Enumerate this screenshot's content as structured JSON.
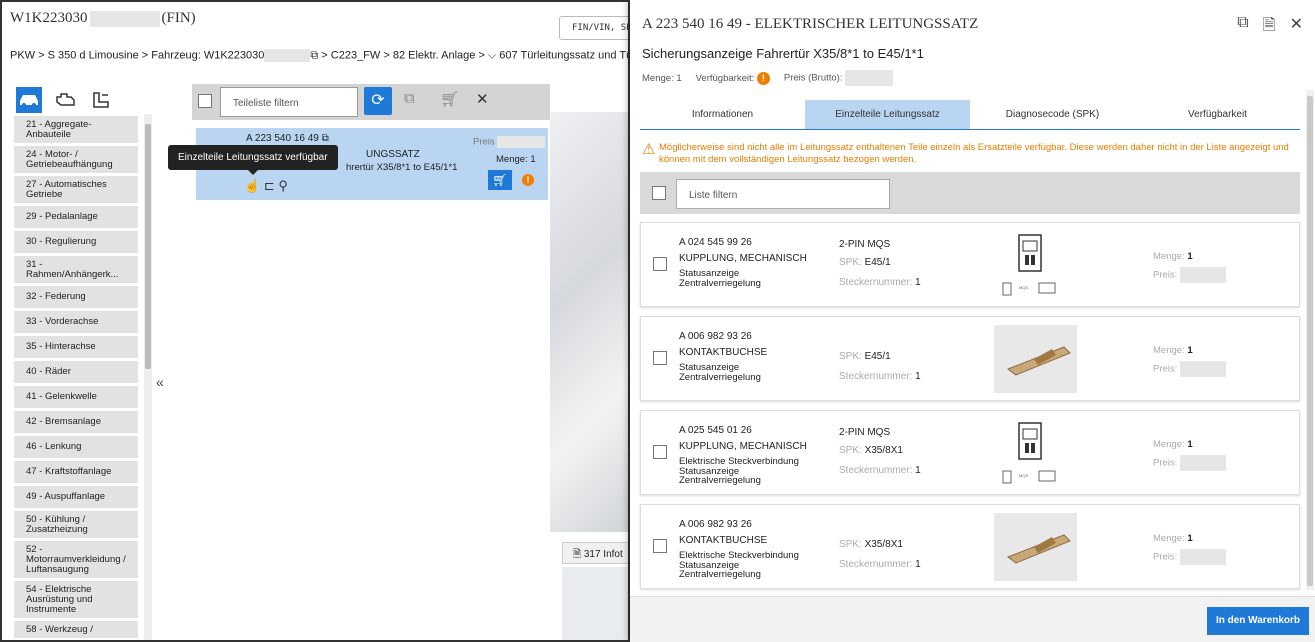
{
  "background_app": {
    "vin_prefix": "W1K223030",
    "vin_suffix": "(FIN)",
    "breadcrumb_start": "PKW > S 350 d Limousine > Fahrzeug: W1K223030",
    "breadcrumb_end": " > C223_FW  > 82 Elektr. Anlage > ⌵ 607 Türleitungssatz und Türst",
    "search_placeholder": "FIN/VIN, SPI",
    "categories": [
      "21 - Aggregate-Anbauteile",
      "24 - Motor- / Getriebeaufhängung",
      "27 - Automatisches Getriebe",
      "29 - Pedalanlage",
      "30 - Regulierung",
      "31 - Rahmen/Anhängerk...",
      "32 - Federung",
      "33 - Vorderachse",
      "35 - Hinterachse",
      "40 - Räder",
      "41 - Gelenkwelle",
      "42 - Bremsanlage",
      "46 - Lenkung",
      "47 - Kraftstoffanlage",
      "49 - Auspuffanlage",
      "50 - Kühlung / Zusatzheizung",
      "52 - Motorraumverkleidung / Luftansaugung",
      "54 - Elektrische Ausrüstung und Instrumente",
      "58 - Werkzeug /"
    ],
    "parts_filter_placeholder": "Teileliste filtern",
    "part_card": {
      "number": "A 223 540 16 49",
      "name": "UNGSSATZ",
      "description": "hrertür X35/8*1 to E45/1*1",
      "preis_label": "Preis",
      "menge": "Menge: 1"
    },
    "tooltip": "Einzelteile Leitungssatz verfügbar",
    "info_tab": "317 Infot"
  },
  "panel": {
    "title": "A 223 540 16 49 - ELEKTRISCHER LEITUNGSSATZ",
    "subtitle": "Sicherungsanzeige Fahrertür X35/8*1 to E45/1*1",
    "menge": "Menge: 1",
    "verfuegbarkeit": "Verfügbarkeit:",
    "preis": "Preis (Brutto):",
    "tabs": [
      "Informationen",
      "Einzelteile Leitungssatz",
      "Diagnosecode (SPK)",
      "Verfügbarkeit"
    ],
    "warning": "Möglicherweise sind nicht alle im Leitungssatz enthaltenen Teile einzeln als Ersatzteile verfügbar. Diese werden daher nicht in der Liste angezeigt und können mit dem vollständigen Leitungssatz bezogen werden.",
    "list_filter_placeholder": "Liste filtern",
    "labels": {
      "spk": "SPK:",
      "steckernummer": "Steckernummer:",
      "menge": "Menge:",
      "preis": "Preis:"
    },
    "items": [
      {
        "number": "A 024 545 99 26",
        "name": "KUPPLUNG, MECHANISCH",
        "desc1": "Statusanzeige",
        "desc2": "Zentralverriegelung",
        "desc3": "",
        "pin": "2-PIN MQS",
        "spk": "E45/1",
        "stecker": "1",
        "menge": "1",
        "image": "connector-drawing"
      },
      {
        "number": "A 006 982 93 26",
        "name": "KONTAKTBUCHSE",
        "desc1": "Statusanzeige",
        "desc2": "Zentralverriegelung",
        "desc3": "",
        "pin": "",
        "spk": "E45/1",
        "stecker": "1",
        "menge": "1",
        "image": "contact-photo"
      },
      {
        "number": "A 025 545 01 26",
        "name": "KUPPLUNG, MECHANISCH",
        "desc1": "Elektrische Steckverbindung",
        "desc2": "Statusanzeige",
        "desc3": "Zentralverriegelung",
        "pin": "2-PIN MQS",
        "spk": "X35/8X1",
        "stecker": "1",
        "menge": "1",
        "image": "connector-drawing"
      },
      {
        "number": "A 006 982 93 26",
        "name": "KONTAKTBUCHSE",
        "desc1": "Elektrische Steckverbindung",
        "desc2": "Statusanzeige",
        "desc3": "Zentralverriegelung",
        "pin": "",
        "spk": "X35/8X1",
        "stecker": "1",
        "menge": "1",
        "image": "contact-photo"
      }
    ],
    "cart_button": "In den Warenkorb"
  }
}
